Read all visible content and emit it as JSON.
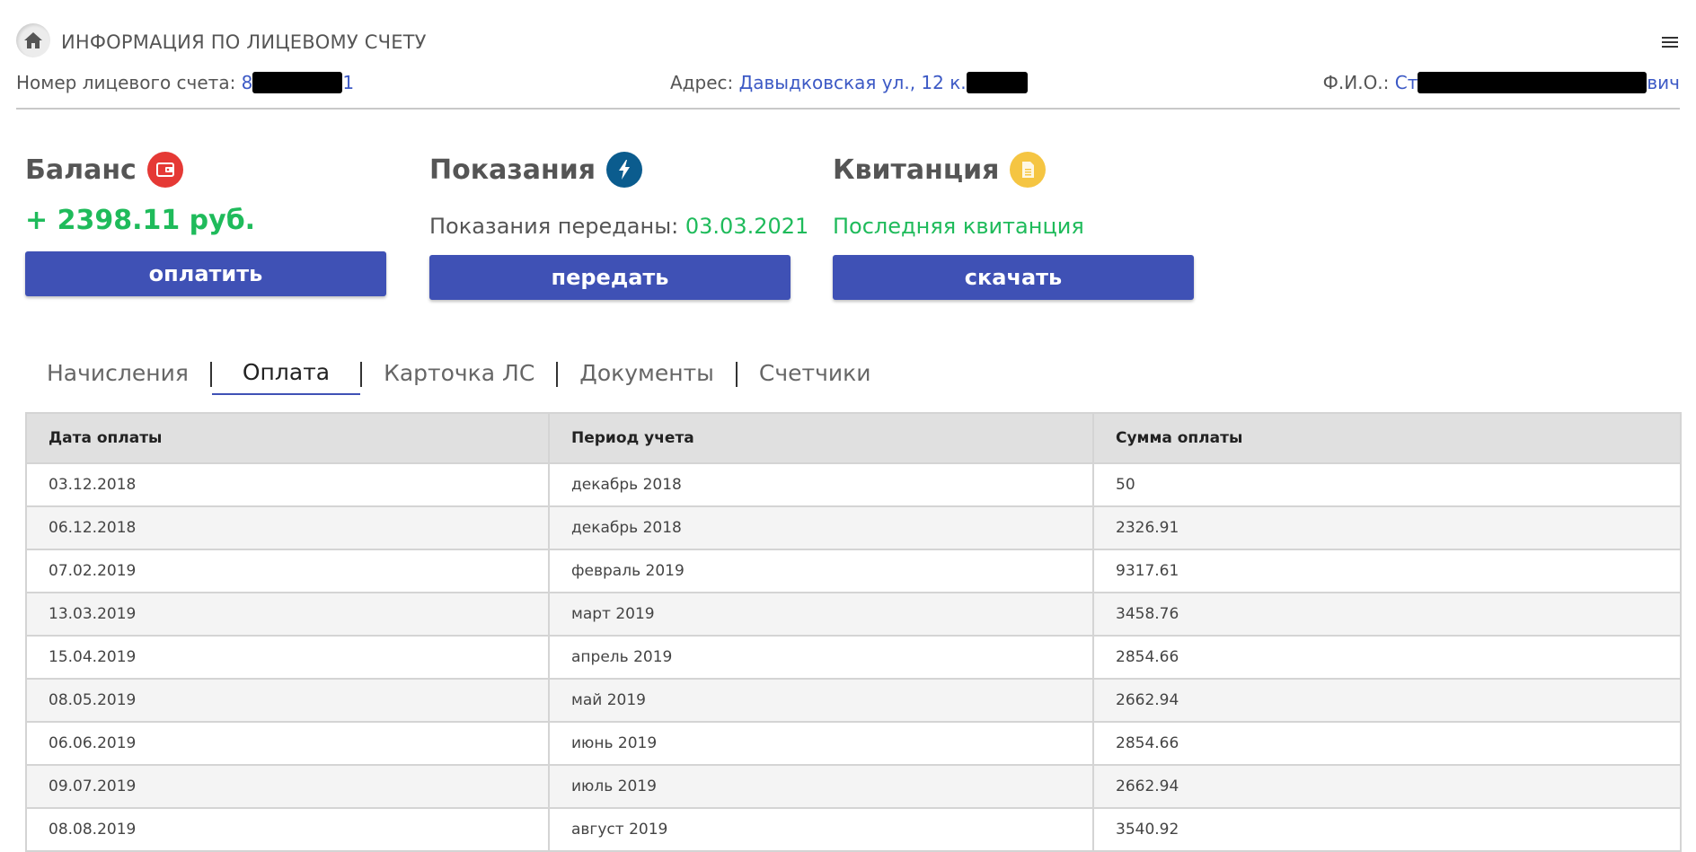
{
  "header": {
    "title": "ИНФОРМАЦИЯ ПО ЛИЦЕВОМУ СЧЕТУ",
    "home_icon": "home-icon",
    "menu_icon": "hamburger-menu-icon"
  },
  "info": {
    "account_label": "Номер лицевого счета:",
    "account_value_start": "8",
    "account_value_end": "1",
    "address_label": "Адрес:",
    "address_value": "Давыдковская ул., 12 к.",
    "fio_label": "Ф.И.О.:",
    "fio_value_start": "Ст",
    "fio_value_end": "вич"
  },
  "cards": {
    "balance": {
      "title": "Баланс",
      "icon": "wallet-icon",
      "value": "+ 2398.11 руб.",
      "button": "оплатить"
    },
    "readings": {
      "title": "Показания",
      "icon": "lightning-icon",
      "label": "Показания переданы:",
      "date": "03.03.2021",
      "button": "передать"
    },
    "receipt": {
      "title": "Квитанция",
      "icon": "document-icon",
      "link": "Последняя квитанция",
      "button": "скачать"
    }
  },
  "tabs": [
    {
      "label": "Начисления",
      "active": false
    },
    {
      "label": "Оплата",
      "active": true
    },
    {
      "label": "Карточка ЛС",
      "active": false
    },
    {
      "label": "Документы",
      "active": false
    },
    {
      "label": "Счетчики",
      "active": false
    }
  ],
  "table": {
    "columns": [
      "Дата оплаты",
      "Период учета",
      "Сумма оплаты"
    ],
    "rows": [
      [
        "03.12.2018",
        "декабрь 2018",
        "50"
      ],
      [
        "06.12.2018",
        "декабрь 2018",
        "2326.91"
      ],
      [
        "07.02.2019",
        "февраль 2019",
        "9317.61"
      ],
      [
        "13.03.2019",
        "март 2019",
        "3458.76"
      ],
      [
        "15.04.2019",
        "апрель 2019",
        "2854.66"
      ],
      [
        "08.05.2019",
        "май 2019",
        "2662.94"
      ],
      [
        "06.06.2019",
        "июнь 2019",
        "2854.66"
      ],
      [
        "09.07.2019",
        "июль 2019",
        "2662.94"
      ],
      [
        "08.08.2019",
        "август 2019",
        "3540.92"
      ]
    ]
  },
  "colors": {
    "primary": "#3f51b5",
    "link": "#3c59c5",
    "success": "#1fbb5b",
    "badge_red": "#e53935",
    "badge_blue": "#0b5c8e",
    "badge_yellow": "#f5c542"
  }
}
